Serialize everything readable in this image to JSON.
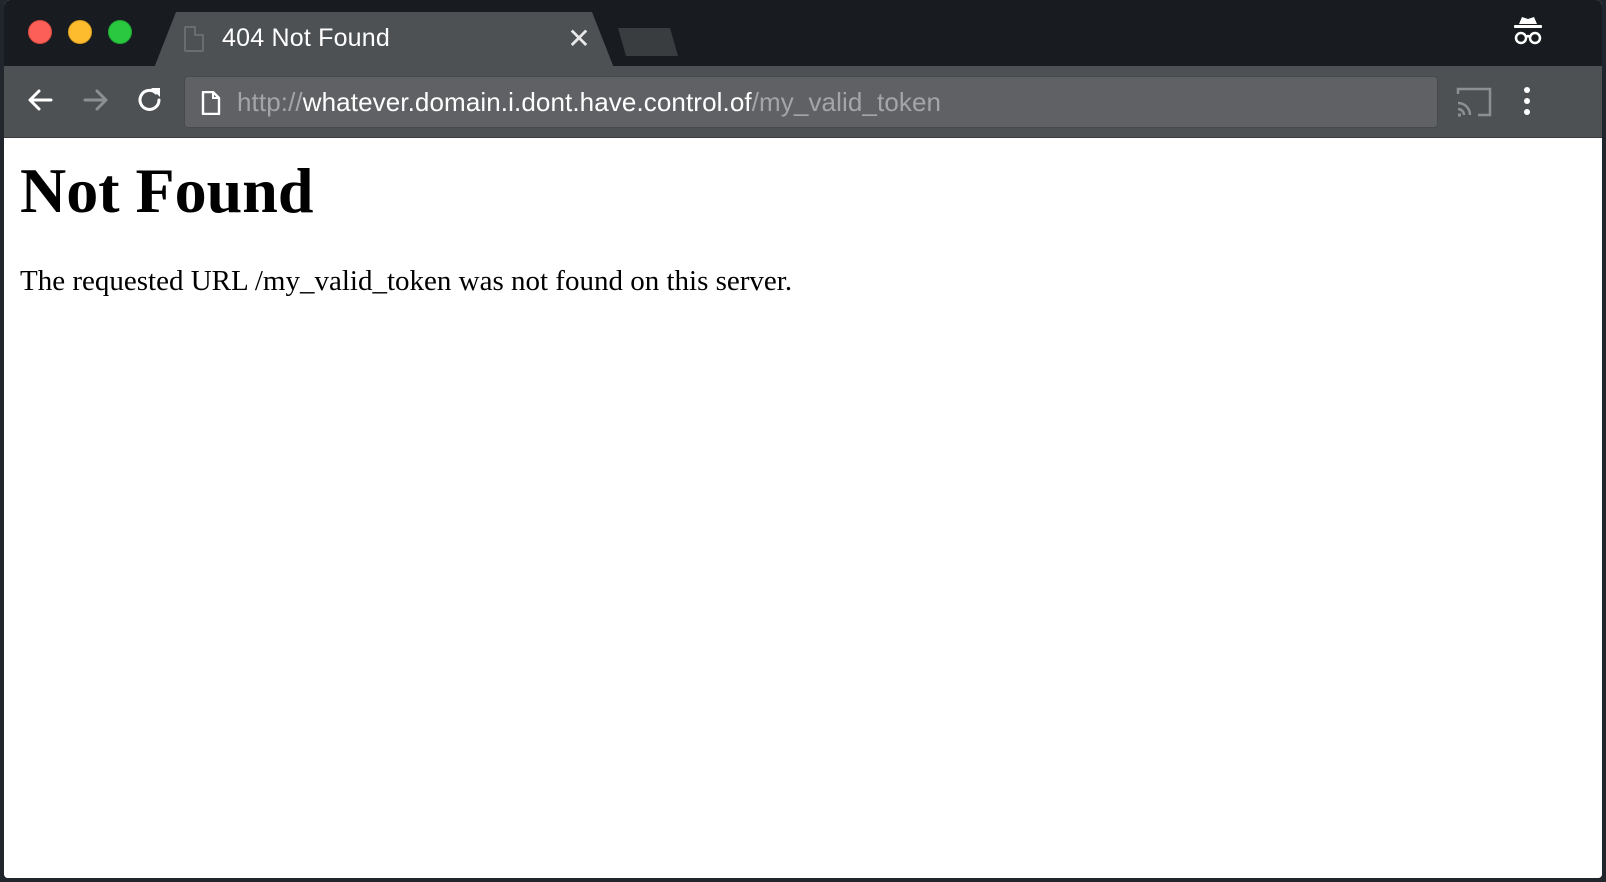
{
  "browser": {
    "tab": {
      "title": "404 Not Found",
      "close_icon": "close-icon",
      "favicon": "document-icon"
    },
    "incognito_icon": "incognito-icon",
    "toolbar": {
      "back_icon": "arrow-left-icon",
      "forward_icon": "arrow-right-icon",
      "reload_icon": "reload-icon",
      "cast_icon": "cast-icon",
      "menu_icon": "kebab-menu-icon"
    },
    "address_bar": {
      "scheme": "http://",
      "host": "whatever.domain.i.dont.have.control.of",
      "path": "/my_valid_token"
    }
  },
  "page": {
    "heading": "Not Found",
    "message": "The requested URL /my_valid_token was not found on this server."
  },
  "colors": {
    "tabstrip_bg": "#181c20",
    "toolbar_bg": "#4e5154",
    "omnibox_bg": "#5f6164",
    "close_red": "#fc5f57",
    "minimize_yellow": "#fdbc2e",
    "maximize_green": "#29c840"
  }
}
